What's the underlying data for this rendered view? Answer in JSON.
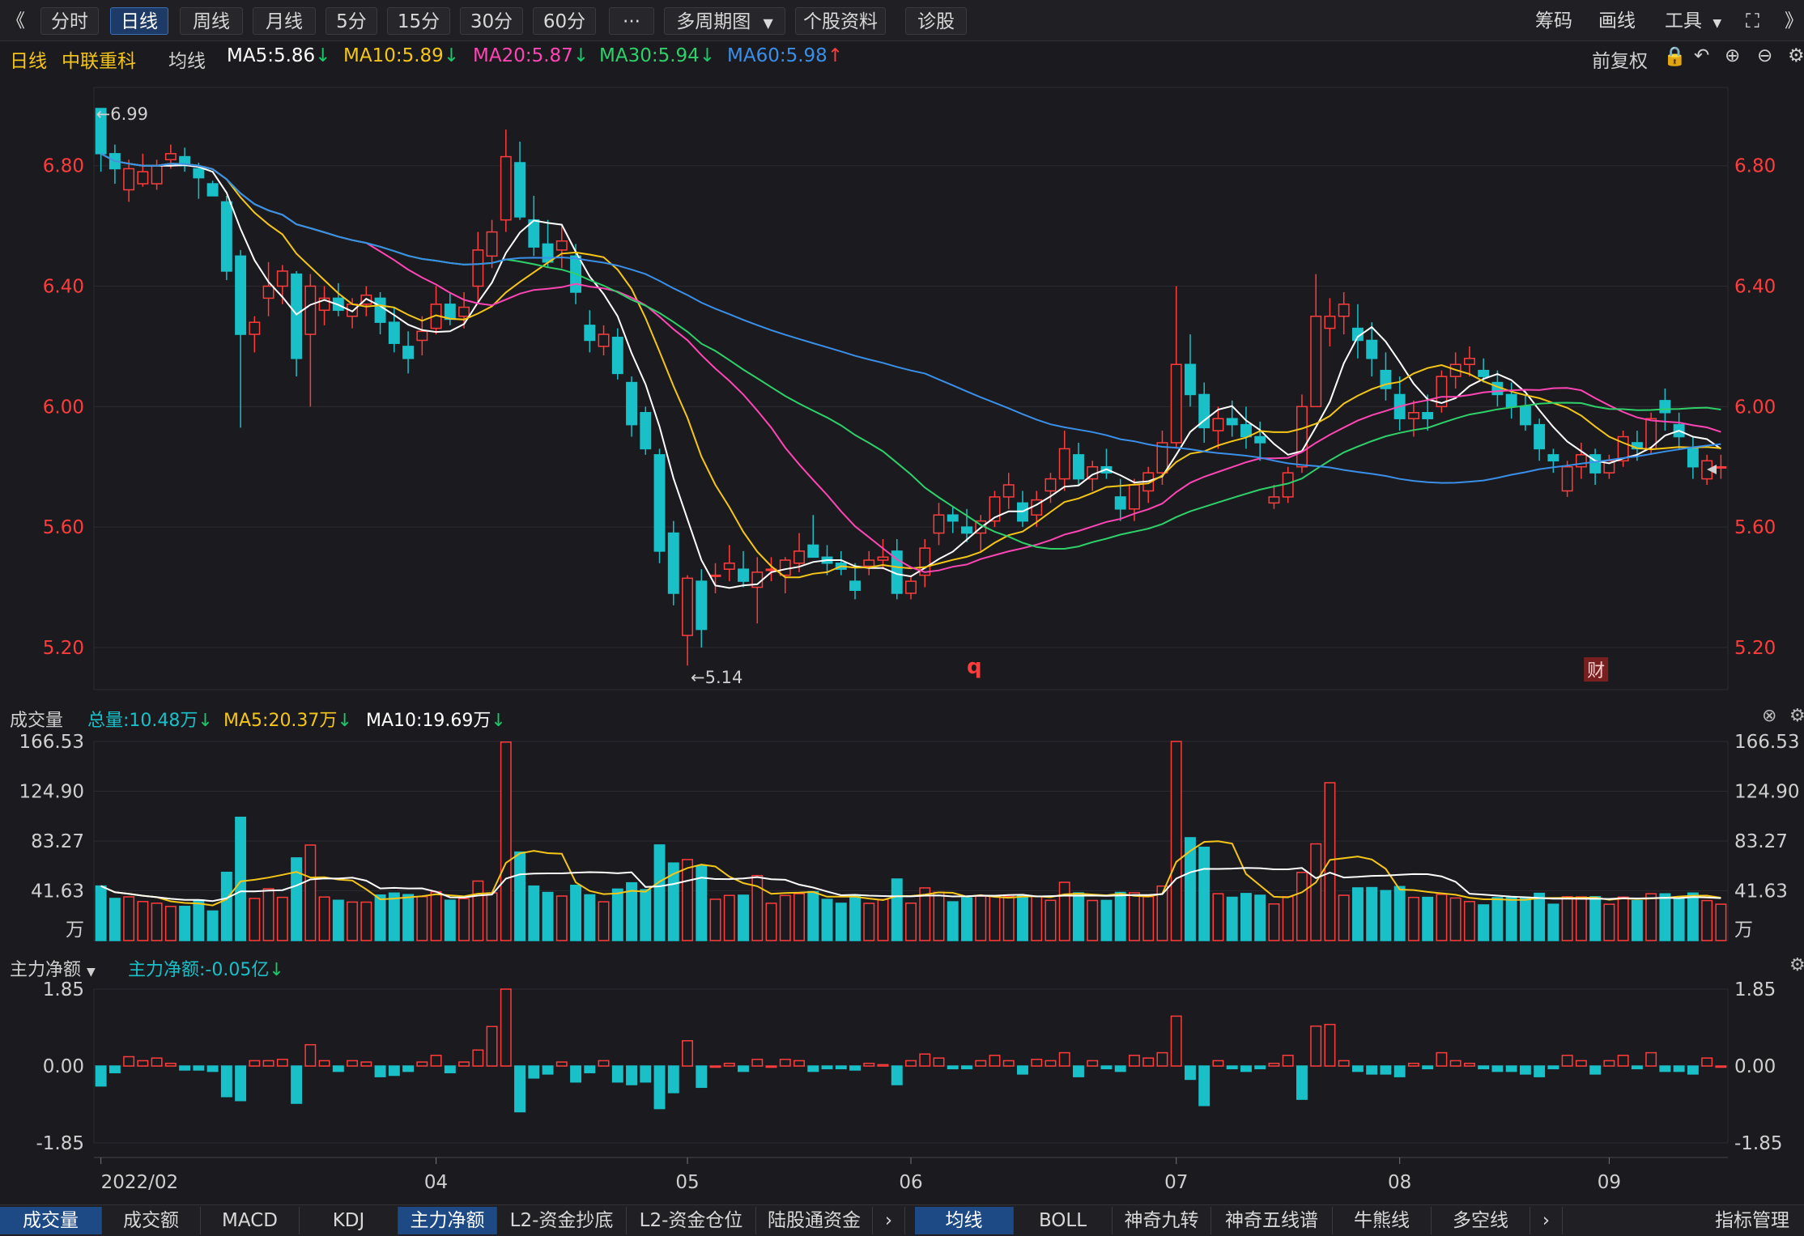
{
  "toolbar": {
    "collapse": "《",
    "periods": [
      "分时",
      "日线",
      "周线",
      "月线",
      "5分",
      "15分",
      "30分",
      "60分"
    ],
    "active_period": "日线",
    "more": "···",
    "multi_period": "多周期图",
    "stock_info": "个股资料",
    "diagnose": "诊股",
    "chips": "筹码",
    "draw": "画线",
    "tools": "工具",
    "expand": "》"
  },
  "info": {
    "period": "日线",
    "stock_name": "中联重科",
    "ma_label": "均线",
    "ma5": "MA5:5.86",
    "ma10": "MA10:5.89",
    "ma20": "MA20:5.87",
    "ma30": "MA30:5.94",
    "ma60": "MA60:5.98",
    "adjust": "前复权"
  },
  "colors": {
    "up": "#ff3c3c",
    "down": "#19c0c8",
    "ma5": "#ffffff",
    "ma10": "#f5c518",
    "ma20": "#ff45b4",
    "ma30": "#2fd06a",
    "ma60": "#3a8fe8"
  },
  "volume_panel": {
    "label": "成交量",
    "total": "总量:10.48万",
    "ma5": "MA5:20.37万",
    "ma10": "MA10:19.69万",
    "unit": "万"
  },
  "flow_panel": {
    "label": "主力净额",
    "value": "主力净额:-0.05亿"
  },
  "chart_data": [
    {
      "type": "candlestick",
      "title": "中联重科 日线",
      "y_ticks": [
        "6.80",
        "6.40",
        "6.00",
        "5.60",
        "5.20"
      ],
      "ylim": [
        5.06,
        7.06
      ],
      "x_ticks": [
        "2022/02",
        "04",
        "05",
        "06",
        "07",
        "08",
        "09"
      ],
      "annotations": [
        "←6.99",
        "←5.14",
        "q",
        "财"
      ],
      "high_label": "6.99",
      "low_label": "5.14",
      "candles_ohlc": [
        [
          6.99,
          6.99,
          6.78,
          6.84
        ],
        [
          6.84,
          6.87,
          6.74,
          6.79
        ],
        [
          6.72,
          6.82,
          6.68,
          6.79
        ],
        [
          6.74,
          6.84,
          6.73,
          6.78
        ],
        [
          6.74,
          6.82,
          6.72,
          6.8
        ],
        [
          6.82,
          6.87,
          6.79,
          6.84
        ],
        [
          6.83,
          6.86,
          6.78,
          6.8
        ],
        [
          6.79,
          6.81,
          6.69,
          6.76
        ],
        [
          6.74,
          6.75,
          6.7,
          6.7
        ],
        [
          6.68,
          6.7,
          6.42,
          6.45
        ],
        [
          6.5,
          6.52,
          5.93,
          6.24
        ],
        [
          6.24,
          6.3,
          6.18,
          6.28
        ],
        [
          6.36,
          6.48,
          6.3,
          6.4
        ],
        [
          6.4,
          6.47,
          6.34,
          6.45
        ],
        [
          6.44,
          6.45,
          6.1,
          6.16
        ],
        [
          6.24,
          6.44,
          6.0,
          6.4
        ],
        [
          6.32,
          6.4,
          6.27,
          6.36
        ],
        [
          6.36,
          6.41,
          6.3,
          6.32
        ],
        [
          6.3,
          6.36,
          6.26,
          6.34
        ],
        [
          6.34,
          6.4,
          6.3,
          6.37
        ],
        [
          6.36,
          6.38,
          6.24,
          6.28
        ],
        [
          6.28,
          6.33,
          6.18,
          6.21
        ],
        [
          6.2,
          6.25,
          6.11,
          6.16
        ],
        [
          6.22,
          6.3,
          6.17,
          6.25
        ],
        [
          6.26,
          6.4,
          6.24,
          6.34
        ],
        [
          6.34,
          6.38,
          6.27,
          6.29
        ],
        [
          6.3,
          6.38,
          6.26,
          6.33
        ],
        [
          6.4,
          6.58,
          6.35,
          6.52
        ],
        [
          6.5,
          6.62,
          6.46,
          6.58
        ],
        [
          6.62,
          6.92,
          6.58,
          6.83
        ],
        [
          6.81,
          6.88,
          6.62,
          6.63
        ],
        [
          6.62,
          6.7,
          6.5,
          6.53
        ],
        [
          6.54,
          6.62,
          6.46,
          6.48
        ],
        [
          6.52,
          6.6,
          6.46,
          6.55
        ],
        [
          6.5,
          6.54,
          6.34,
          6.38
        ],
        [
          6.27,
          6.32,
          6.18,
          6.22
        ],
        [
          6.2,
          6.27,
          6.17,
          6.24
        ],
        [
          6.23,
          6.26,
          6.09,
          6.11
        ],
        [
          6.08,
          6.1,
          5.9,
          5.94
        ],
        [
          5.98,
          6.0,
          5.84,
          5.86
        ],
        [
          5.84,
          5.86,
          5.48,
          5.52
        ],
        [
          5.58,
          5.62,
          5.34,
          5.38
        ],
        [
          5.24,
          5.44,
          5.14,
          5.43
        ],
        [
          5.42,
          5.46,
          5.2,
          5.26
        ],
        [
          5.44,
          5.48,
          5.38,
          5.44
        ],
        [
          5.46,
          5.54,
          5.42,
          5.48
        ],
        [
          5.46,
          5.52,
          5.4,
          5.42
        ],
        [
          5.4,
          5.5,
          5.28,
          5.45
        ],
        [
          5.46,
          5.5,
          5.42,
          5.46
        ],
        [
          5.44,
          5.5,
          5.38,
          5.49
        ],
        [
          5.48,
          5.58,
          5.45,
          5.52
        ],
        [
          5.54,
          5.64,
          5.5,
          5.5
        ],
        [
          5.5,
          5.54,
          5.44,
          5.48
        ],
        [
          5.48,
          5.52,
          5.44,
          5.46
        ],
        [
          5.42,
          5.48,
          5.36,
          5.39
        ],
        [
          5.47,
          5.52,
          5.44,
          5.49
        ],
        [
          5.49,
          5.56,
          5.46,
          5.5
        ],
        [
          5.52,
          5.56,
          5.36,
          5.38
        ],
        [
          5.38,
          5.44,
          5.36,
          5.42
        ],
        [
          5.44,
          5.56,
          5.4,
          5.53
        ],
        [
          5.58,
          5.68,
          5.54,
          5.64
        ],
        [
          5.64,
          5.67,
          5.58,
          5.62
        ],
        [
          5.6,
          5.66,
          5.55,
          5.58
        ],
        [
          5.58,
          5.64,
          5.52,
          5.62
        ],
        [
          5.62,
          5.72,
          5.6,
          5.7
        ],
        [
          5.7,
          5.78,
          5.66,
          5.74
        ],
        [
          5.68,
          5.72,
          5.6,
          5.62
        ],
        [
          5.64,
          5.72,
          5.6,
          5.69
        ],
        [
          5.72,
          5.78,
          5.68,
          5.76
        ],
        [
          5.76,
          5.92,
          5.72,
          5.86
        ],
        [
          5.84,
          5.88,
          5.74,
          5.76
        ],
        [
          5.76,
          5.82,
          5.72,
          5.8
        ],
        [
          5.8,
          5.86,
          5.76,
          5.78
        ],
        [
          5.7,
          5.76,
          5.62,
          5.66
        ],
        [
          5.66,
          5.76,
          5.62,
          5.74
        ],
        [
          5.72,
          5.8,
          5.68,
          5.78
        ],
        [
          5.78,
          5.92,
          5.74,
          5.88
        ],
        [
          5.88,
          6.4,
          5.86,
          6.14
        ],
        [
          6.14,
          6.24,
          6.0,
          6.04
        ],
        [
          6.04,
          6.08,
          5.88,
          5.93
        ],
        [
          5.92,
          6.0,
          5.86,
          5.96
        ],
        [
          5.96,
          6.02,
          5.9,
          5.94
        ],
        [
          5.94,
          6.0,
          5.86,
          5.9
        ],
        [
          5.9,
          5.95,
          5.82,
          5.88
        ],
        [
          5.68,
          5.74,
          5.66,
          5.7
        ],
        [
          5.7,
          5.8,
          5.68,
          5.78
        ],
        [
          5.8,
          6.04,
          5.78,
          6.0
        ],
        [
          6.0,
          6.44,
          6.0,
          6.3
        ],
        [
          6.26,
          6.36,
          6.2,
          6.3
        ],
        [
          6.3,
          6.38,
          6.24,
          6.34
        ],
        [
          6.26,
          6.34,
          6.16,
          6.22
        ],
        [
          6.22,
          6.28,
          6.1,
          6.16
        ],
        [
          6.12,
          6.18,
          6.02,
          6.06
        ],
        [
          6.04,
          6.1,
          5.92,
          5.96
        ],
        [
          5.96,
          6.02,
          5.9,
          5.98
        ],
        [
          5.98,
          6.04,
          5.92,
          5.96
        ],
        [
          6.0,
          6.12,
          5.98,
          6.1
        ],
        [
          6.1,
          6.18,
          6.06,
          6.14
        ],
        [
          6.14,
          6.2,
          6.1,
          6.16
        ],
        [
          6.12,
          6.16,
          6.08,
          6.1
        ],
        [
          6.08,
          6.12,
          6.0,
          6.04
        ],
        [
          6.04,
          6.08,
          5.96,
          6.0
        ],
        [
          6.0,
          6.04,
          5.92,
          5.94
        ],
        [
          5.94,
          5.96,
          5.82,
          5.86
        ],
        [
          5.84,
          5.86,
          5.78,
          5.82
        ],
        [
          5.72,
          5.82,
          5.7,
          5.8
        ],
        [
          5.8,
          5.88,
          5.76,
          5.84
        ],
        [
          5.84,
          5.86,
          5.74,
          5.78
        ],
        [
          5.78,
          5.84,
          5.76,
          5.82
        ],
        [
          5.82,
          5.92,
          5.8,
          5.9
        ],
        [
          5.88,
          5.92,
          5.82,
          5.86
        ],
        [
          5.86,
          5.98,
          5.84,
          5.96
        ],
        [
          6.02,
          6.06,
          5.92,
          5.98
        ],
        [
          5.94,
          5.98,
          5.86,
          5.9
        ],
        [
          5.86,
          5.9,
          5.76,
          5.8
        ],
        [
          5.76,
          5.84,
          5.74,
          5.82
        ],
        [
          5.8,
          5.84,
          5.76,
          5.8
        ]
      ]
    },
    {
      "type": "bar",
      "title": "成交量",
      "y_ticks": [
        "166.53",
        "124.90",
        "83.27",
        "41.63"
      ],
      "ylim": [
        0,
        166.53
      ],
      "unit": "万"
    },
    {
      "type": "bar",
      "title": "主力净额",
      "y_ticks": [
        "1.85",
        "0.00",
        "-1.85"
      ],
      "ylim": [
        -1.85,
        1.85
      ],
      "unit": "亿"
    }
  ],
  "bottom_tabs_left": [
    "成交量",
    "成交额",
    "MACD",
    "KDJ",
    "主力净额",
    "L2-资金抄底",
    "L2-资金仓位",
    "陆股通资金"
  ],
  "bottom_tabs_left_active": "主力净额",
  "bottom_tabs_right": [
    "均线",
    "BOLL",
    "神奇九转",
    "神奇五线谱",
    "牛熊线",
    "多空线"
  ],
  "bottom_tabs_right_active": "均线",
  "indicator_manage": "指标管理"
}
